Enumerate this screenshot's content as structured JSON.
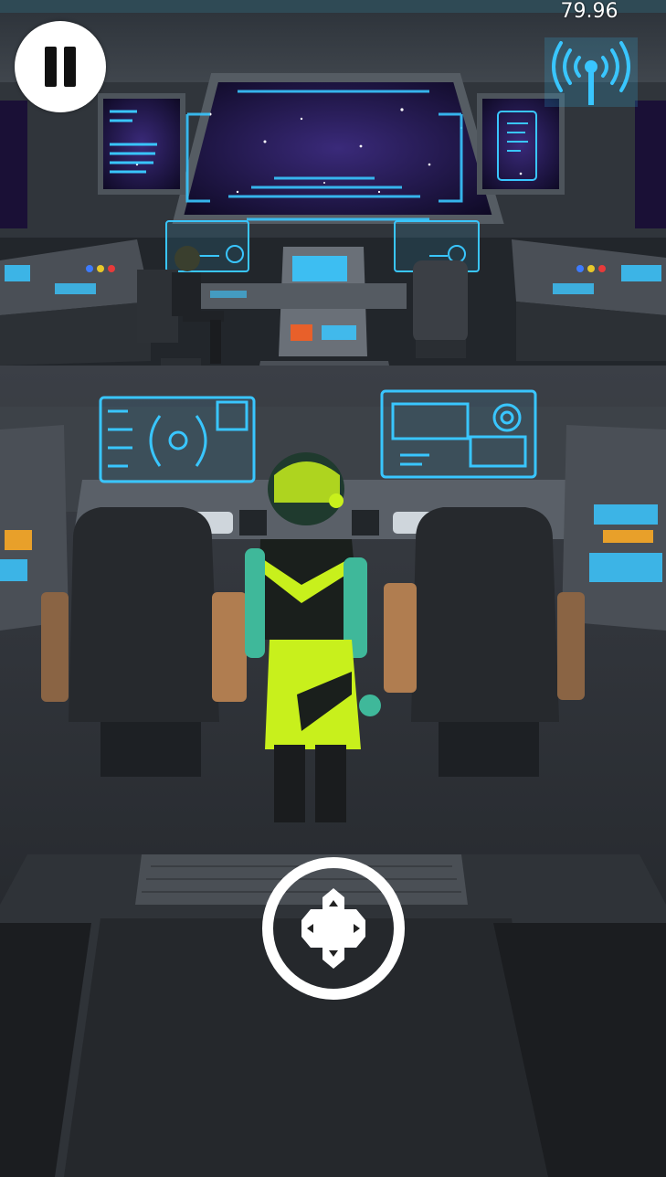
{
  "hud": {
    "timer": "79.96",
    "pause_icon": "pause-icon",
    "signal_icon": "radio-signal-icon",
    "move_icon": "dpad-move-icon"
  },
  "colors": {
    "hologram": "#39c6ff",
    "space": "#1a1036",
    "floor": "#2a2d33",
    "player_suit": "#c8f01c"
  }
}
